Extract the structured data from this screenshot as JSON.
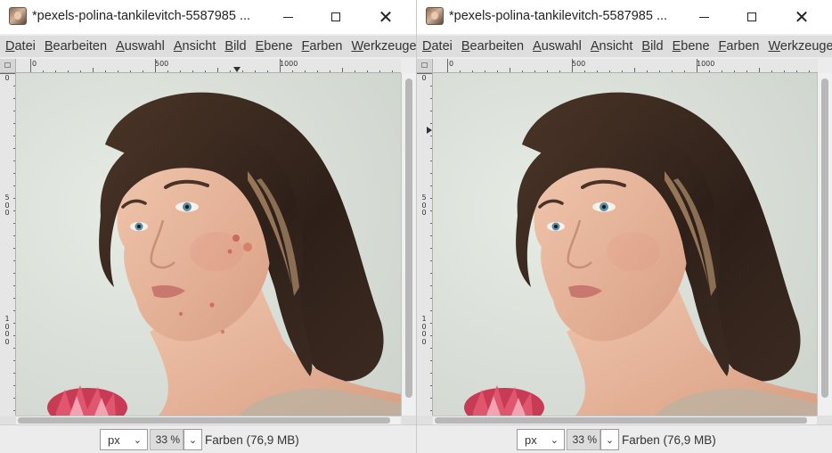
{
  "windows": [
    {
      "id": "before",
      "title": "*pexels-polina-tankilevitch-5587985 ...",
      "menus": [
        "Datei",
        "Bearbeiten",
        "Auswahl",
        "Ansicht",
        "Bild",
        "Ebene",
        "Farben",
        "Werkzeuge"
      ],
      "ruler_h": [
        "0",
        "500",
        "1000"
      ],
      "ruler_v": [
        "0",
        "500",
        "1000"
      ],
      "unit": "px",
      "zoom": "33 %",
      "status": "Farben (76,9 MB)",
      "blemishes": true
    },
    {
      "id": "after",
      "title": "*pexels-polina-tankilevitch-5587985 ...",
      "menus": [
        "Datei",
        "Bearbeiten",
        "Auswahl",
        "Ansicht",
        "Bild",
        "Ebene",
        "Farben",
        "Werkzeuge"
      ],
      "ruler_h": [
        "0",
        "500",
        "1000"
      ],
      "ruler_v": [
        "0",
        "500",
        "1000"
      ],
      "unit": "px",
      "zoom": "33 %",
      "status": "Farben (76,9 MB)",
      "blemishes": false
    }
  ],
  "icons": {
    "app": "gimp-image-icon",
    "minimize": "minimize-icon",
    "maximize": "maximize-icon",
    "close": "close-icon",
    "dropdown": "chevron-down-icon"
  },
  "colors": {
    "menubar": "#dedede",
    "canvas_bg": "#dde3dc",
    "skin": "#e6b59b",
    "hair": "#3d2b20"
  }
}
